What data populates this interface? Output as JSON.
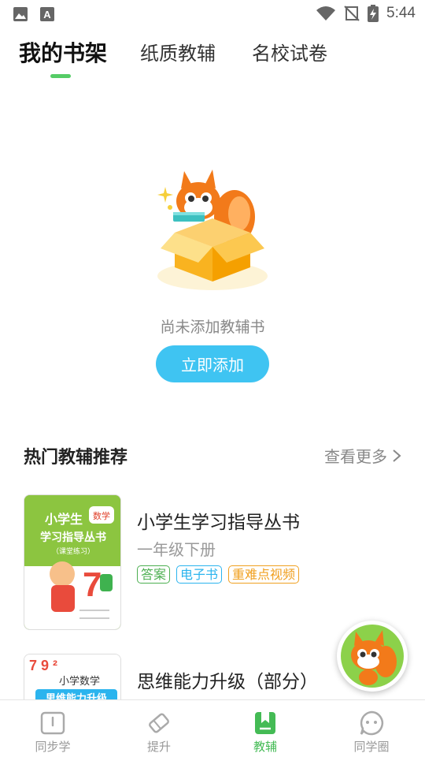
{
  "status_bar": {
    "time": "5:44",
    "icons": [
      "image-icon",
      "font-icon",
      "wifi-icon",
      "no-signal-icon",
      "battery-charging-icon"
    ]
  },
  "tabs": [
    {
      "label": "我的书架",
      "active": true
    },
    {
      "label": "纸质教辅",
      "active": false
    },
    {
      "label": "名校试卷",
      "active": false
    }
  ],
  "empty_state": {
    "message": "尚未添加教辅书",
    "button_label": "立即添加"
  },
  "hot_section": {
    "title": "热门教辅推荐",
    "see_more": "查看更多"
  },
  "books": [
    {
      "title": "小学生学习指导丛书",
      "subtitle": "一年级下册",
      "tags": [
        "答案",
        "电子书",
        "重难点视频"
      ],
      "cover_text": {
        "series": "小学生",
        "title": "学习指导丛书",
        "badge": "数学",
        "sub": "（课堂练习）"
      }
    },
    {
      "title": "思维能力升级（部分）",
      "cover_text": {
        "title": "小学数学",
        "sub": "思维能力升级"
      }
    }
  ],
  "bottom_nav": [
    {
      "label": "同步学",
      "icon": "book-icon",
      "active": false
    },
    {
      "label": "提升",
      "icon": "eraser-icon",
      "active": false
    },
    {
      "label": "教辅",
      "icon": "bookmark-book-icon",
      "active": true
    },
    {
      "label": "同学圈",
      "icon": "chat-face-icon",
      "active": false
    }
  ],
  "colors": {
    "accent_green": "#44bb55",
    "button_blue": "#3fc4f2",
    "mascot_orange": "#f27a1a"
  }
}
